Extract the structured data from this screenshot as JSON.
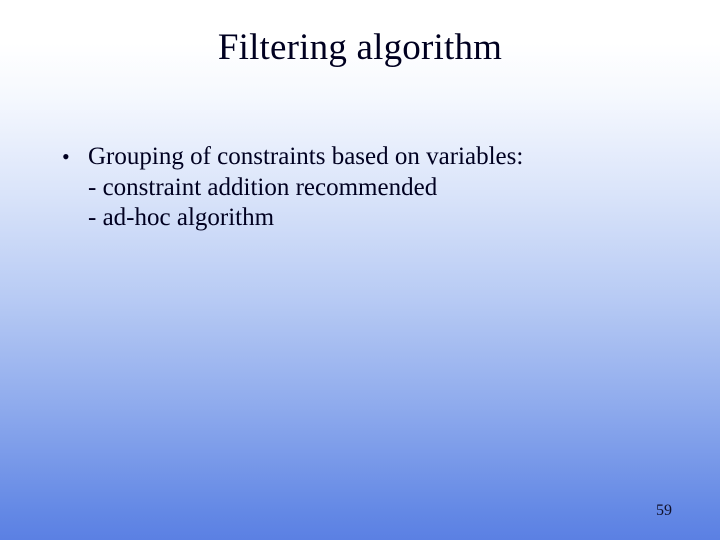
{
  "title": "Filtering algorithm",
  "bullet": {
    "marker": "•",
    "line1": "Grouping of constraints based on variables:",
    "line2": "- constraint addition recommended",
    "line3": "- ad-hoc algorithm"
  },
  "page_number": "59"
}
